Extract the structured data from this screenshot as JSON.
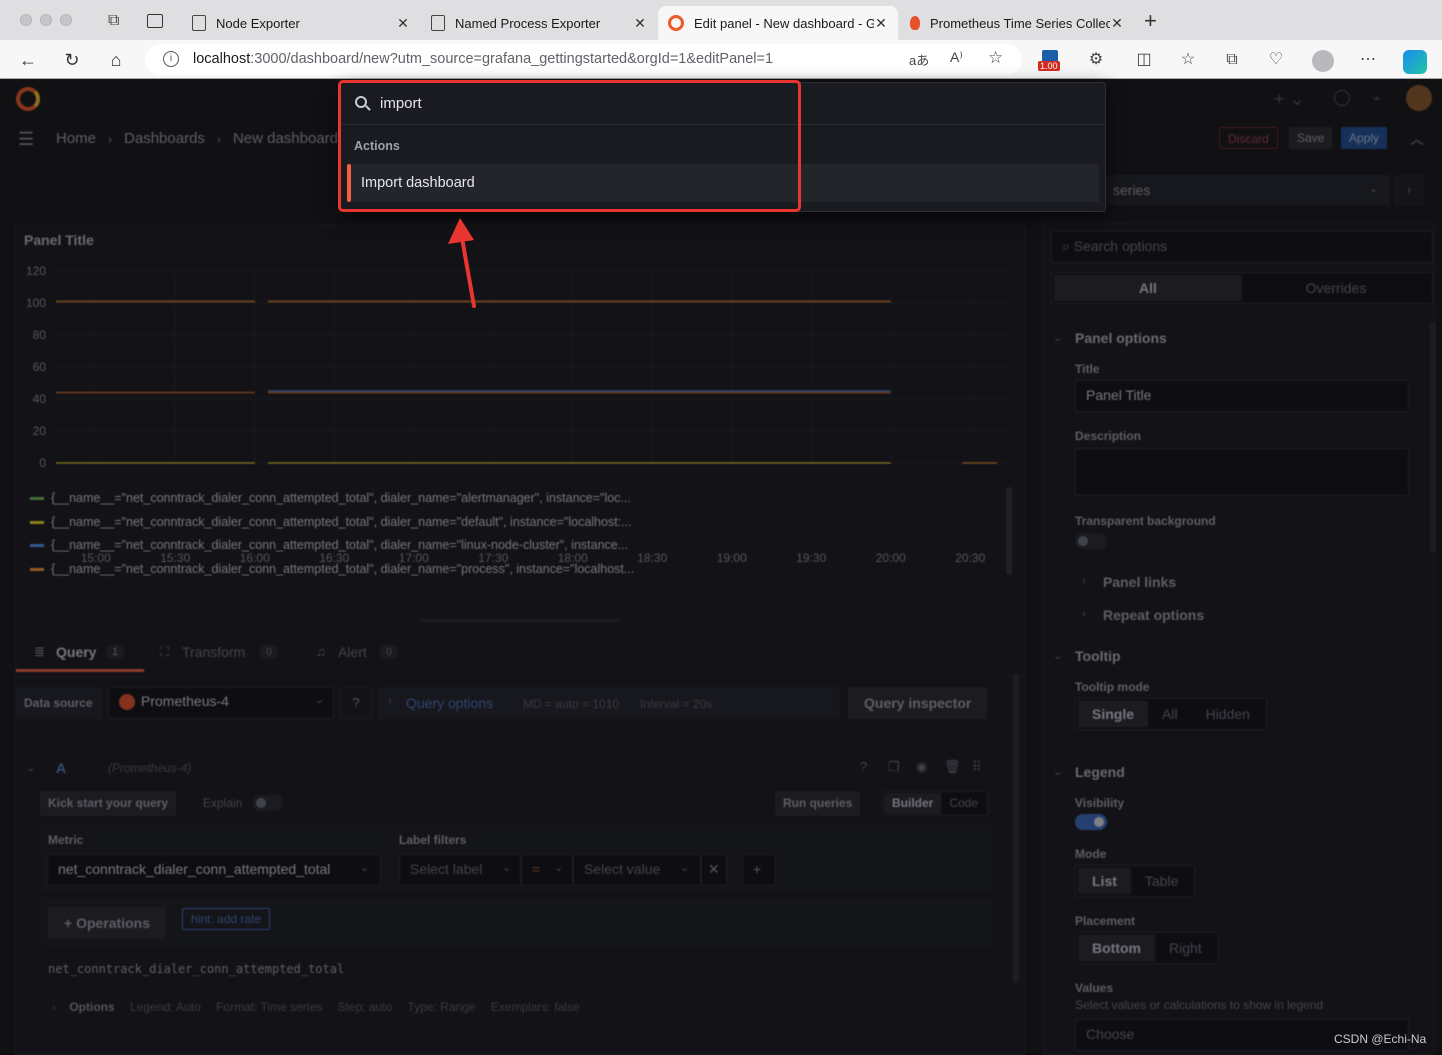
{
  "browser": {
    "tabs": [
      {
        "title": "Node Exporter"
      },
      {
        "title": "Named Process Exporter"
      },
      {
        "title": "Edit panel - New dashboard - G"
      },
      {
        "title": "Prometheus Time Series Collec"
      }
    ],
    "url_host": "localhost",
    "url_rest": ":3000/dashboard/new?utm_source=grafana_gettingstarted&orgId=1&editPanel=1",
    "ext_badge": "1.00"
  },
  "breadcrumb": [
    "Home",
    "Dashboards",
    "New dashboard"
  ],
  "toolbar": {
    "discard": "Discard",
    "save": "Save",
    "apply": "Apply"
  },
  "viz_picker": {
    "label": "series"
  },
  "search": {
    "query": "import",
    "section": "Actions",
    "result": "Import dashboard"
  },
  "panel": {
    "title": "Panel Title",
    "y_ticks": [
      "120",
      "100",
      "80",
      "60",
      "40",
      "20",
      "0"
    ],
    "x_ticks": [
      "15:00",
      "15:30",
      "16:00",
      "16:30",
      "17:00",
      "17:30",
      "18:00",
      "18:30",
      "19:00",
      "19:30",
      "20:00",
      "20:30"
    ],
    "legend": [
      {
        "color": "#73bf69",
        "text": "{__name__=\"net_conntrack_dialer_conn_attempted_total\", dialer_name=\"alertmanager\", instance=\"loc..."
      },
      {
        "color": "#fade2a",
        "text": "{__name__=\"net_conntrack_dialer_conn_attempted_total\", dialer_name=\"default\", instance=\"localhost:..."
      },
      {
        "color": "#5794f2",
        "text": "{__name__=\"net_conntrack_dialer_conn_attempted_total\", dialer_name=\"linux-node-cluster\", instance..."
      },
      {
        "color": "#ff9830",
        "text": "{__name__=\"net_conntrack_dialer_conn_attempted_total\", dialer_name=\"process\", instance=\"localhost..."
      }
    ]
  },
  "chart_data": {
    "type": "line",
    "x": [
      "15:00",
      "15:30",
      "16:00",
      "16:30",
      "17:00",
      "17:30",
      "18:00",
      "18:30",
      "19:00",
      "19:30",
      "20:00",
      "20:30"
    ],
    "ylim": [
      0,
      120
    ],
    "series": [
      {
        "color": "#ff9830",
        "segments": [
          [
            [
              "14:45",
              101
            ],
            [
              "16:00",
              101
            ]
          ],
          [
            [
              "16:05",
              101
            ],
            [
              "20:00",
              101
            ]
          ]
        ]
      },
      {
        "color": "#e0752d",
        "segments": [
          [
            [
              "14:45",
              44
            ],
            [
              "16:00",
              44
            ]
          ],
          [
            [
              "16:05",
              44
            ],
            [
              "20:00",
              44
            ]
          ]
        ]
      },
      {
        "color": "#5794f2",
        "segments": [
          [
            [
              "16:05",
              45
            ],
            [
              "20:00",
              45
            ]
          ]
        ]
      },
      {
        "color": "#fade2a",
        "segments": [
          [
            [
              "14:45",
              0
            ],
            [
              "16:00",
              0
            ]
          ],
          [
            [
              "16:05",
              0
            ],
            [
              "20:00",
              0
            ]
          ]
        ]
      },
      {
        "color": "#ff9830",
        "segments": [
          [
            [
              "20:27",
              0
            ],
            [
              "20:40",
              0
            ]
          ]
        ]
      }
    ]
  },
  "query_tabs": [
    {
      "label": "Query",
      "count": "1"
    },
    {
      "label": "Transform",
      "count": "0"
    },
    {
      "label": "Alert",
      "count": "0"
    }
  ],
  "datasource": {
    "label": "Data source",
    "name": "Prometheus-4"
  },
  "query_options": {
    "label": "Query options",
    "md": "MD = auto = 1010",
    "interval": "Interval = 20s"
  },
  "query_inspector": "Query inspector",
  "query_row": {
    "ref": "A",
    "source": "(Prometheus-4)",
    "kick_start": "Kick start your query",
    "explain": "Explain",
    "run": "Run queries",
    "builder": "Builder",
    "code": "Code",
    "metric_label": "Metric",
    "metric": "net_conntrack_dialer_conn_attempted_total",
    "label_filters": "Label filters",
    "select_label": "Select label",
    "op": "=",
    "select_value": "Select value",
    "operations": "Operations",
    "hint": "hint: add rate",
    "raw": "net_conntrack_dialer_conn_attempted_total",
    "options": "Options",
    "legend": "Legend: Auto",
    "format": "Format: Time series",
    "step": "Step: auto",
    "qtype": "Type: Range",
    "exemplars": "Exemplars: false"
  },
  "options_pane": {
    "search_placeholder": "Search options",
    "all": "All",
    "overrides": "Overrides",
    "panel_options": "Panel options",
    "title_label": "Title",
    "title_value": "Panel Title",
    "description_label": "Description",
    "transparent_label": "Transparent background",
    "panel_links": "Panel links",
    "repeat_options": "Repeat options",
    "tooltip": "Tooltip",
    "tooltip_mode": "Tooltip mode",
    "tooltip_opts": [
      "Single",
      "All",
      "Hidden"
    ],
    "legend": "Legend",
    "visibility": "Visibility",
    "mode": "Mode",
    "mode_opts": [
      "List",
      "Table"
    ],
    "placement": "Placement",
    "placement_opts": [
      "Bottom",
      "Right"
    ],
    "values": "Values",
    "values_desc": "Select values or calculations to show in legend",
    "choose": "Choose"
  },
  "watermark": "CSDN @Echi-Na"
}
